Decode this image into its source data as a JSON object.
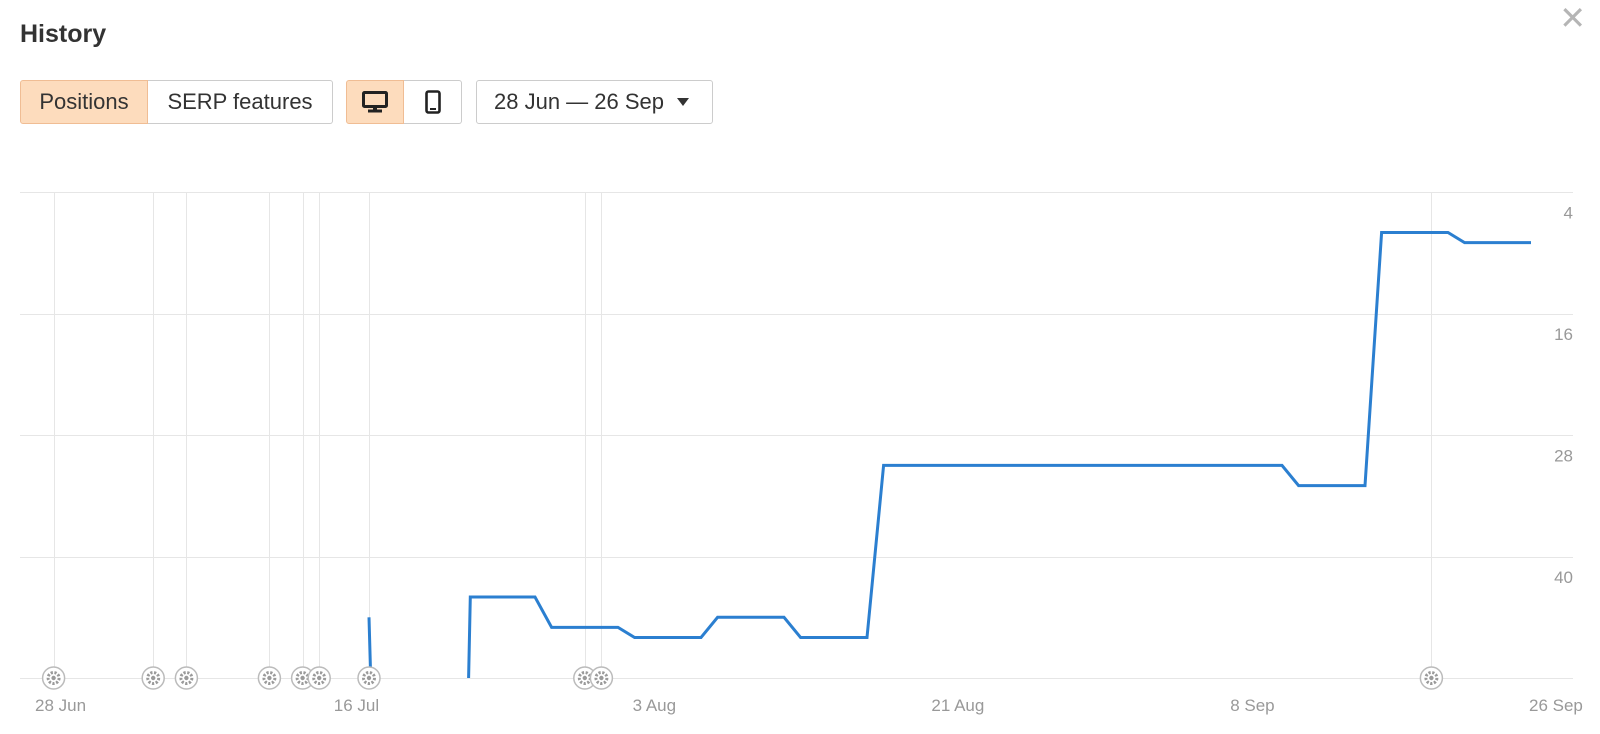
{
  "header": {
    "title": "History",
    "close_icon": "close-icon"
  },
  "toolbar": {
    "tabs": [
      {
        "label": "Positions",
        "active": true
      },
      {
        "label": "SERP features",
        "active": false
      }
    ],
    "devices": [
      {
        "icon": "desktop-icon",
        "active": true
      },
      {
        "icon": "mobile-icon",
        "active": false
      }
    ],
    "date_range": "28 Jun — 26 Sep"
  },
  "colors": {
    "accent": "#fddcbd",
    "accent_border": "#f0bd94",
    "line": "#2b7fd0",
    "grid": "#e6e6e6",
    "marker": "#bbbbbb"
  },
  "chart_data": {
    "type": "line",
    "x_unit": "date",
    "x_range": [
      "2023-06-28",
      "2023-09-29"
    ],
    "y_reversed": true,
    "y_range": [
      2,
      50
    ],
    "y_ticks": [
      4,
      16,
      28,
      40
    ],
    "x_ticks": [
      {
        "date": "2023-06-28",
        "label": "28 Jun"
      },
      {
        "date": "2023-07-16",
        "label": "16 Jul"
      },
      {
        "date": "2023-08-03",
        "label": "3 Aug"
      },
      {
        "date": "2023-08-21",
        "label": "21 Aug"
      },
      {
        "date": "2023-09-08",
        "label": "8 Sep"
      },
      {
        "date": "2023-09-26",
        "label": "26 Sep"
      }
    ],
    "grid": true,
    "events": [
      "2023-06-29",
      "2023-07-05",
      "2023-07-07",
      "2023-07-12",
      "2023-07-14",
      "2023-07-15",
      "2023-07-18",
      "2023-07-31",
      "2023-08-01",
      "2023-09-20"
    ],
    "series": [
      {
        "segments": [
          [
            {
              "x": "2023-07-18",
              "y": 44
            },
            {
              "x": "2023-07-18.1",
              "y": 50
            },
            {
              "x": "2023-07-17.9",
              "y": 50
            }
          ],
          [
            {
              "x": "2023-07-24",
              "y": 50
            },
            {
              "x": "2023-07-24.1",
              "y": 42
            },
            {
              "x": "2023-07-28",
              "y": 42
            },
            {
              "x": "2023-07-29",
              "y": 45
            },
            {
              "x": "2023-08-02",
              "y": 45
            },
            {
              "x": "2023-08-03",
              "y": 46
            },
            {
              "x": "2023-08-07",
              "y": 46
            },
            {
              "x": "2023-08-08",
              "y": 44
            },
            {
              "x": "2023-08-12",
              "y": 44
            },
            {
              "x": "2023-08-13",
              "y": 46
            },
            {
              "x": "2023-08-17",
              "y": 46
            },
            {
              "x": "2023-08-18",
              "y": 29
            },
            {
              "x": "2023-09-11",
              "y": 29
            },
            {
              "x": "2023-09-12",
              "y": 31
            },
            {
              "x": "2023-09-16",
              "y": 31
            },
            {
              "x": "2023-09-17",
              "y": 6
            },
            {
              "x": "2023-09-21",
              "y": 6
            },
            {
              "x": "2023-09-22",
              "y": 7
            },
            {
              "x": "2023-09-26",
              "y": 7
            }
          ]
        ]
      }
    ]
  }
}
